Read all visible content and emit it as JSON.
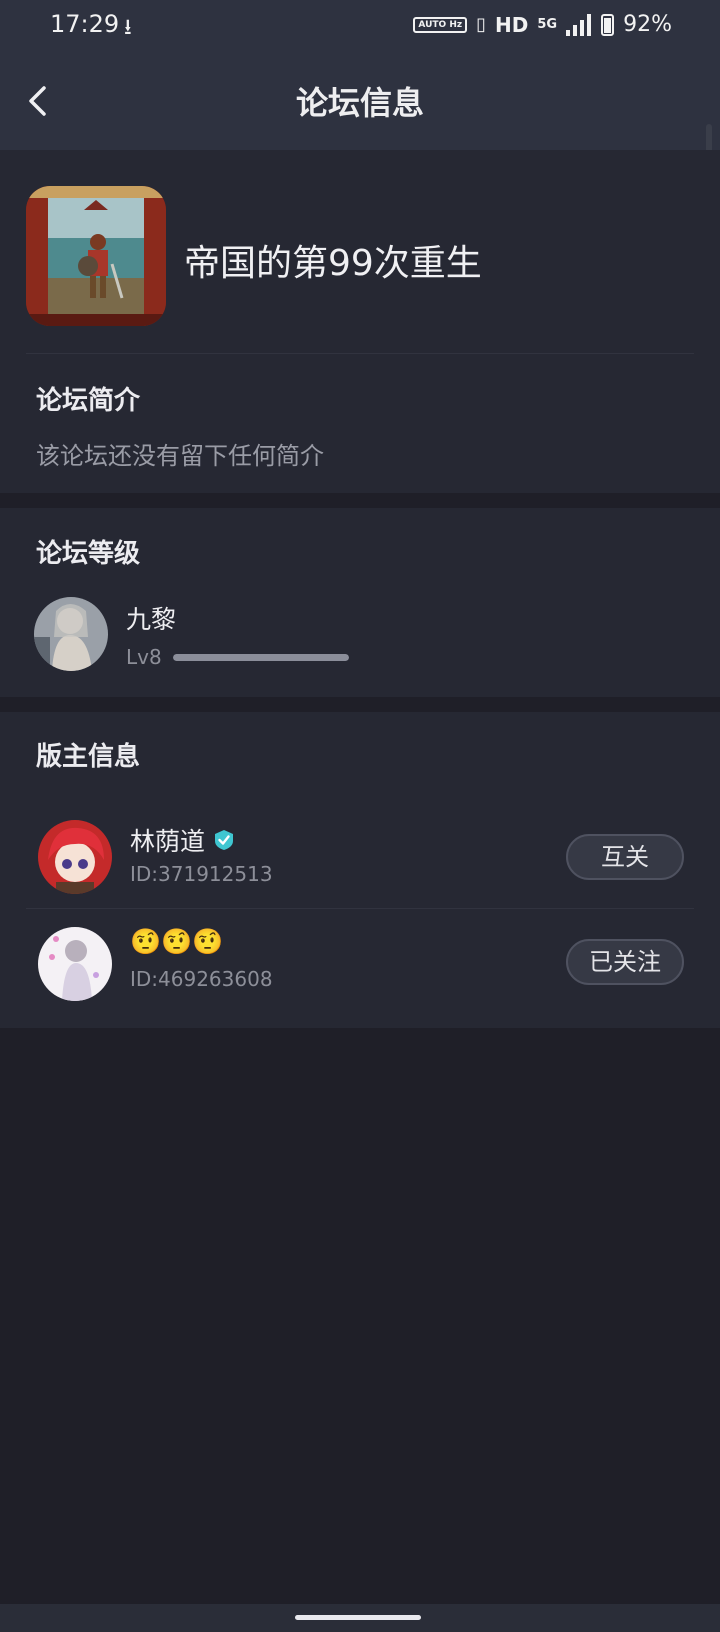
{
  "status_bar": {
    "time": "17:29",
    "download_icon": "download-icon",
    "auto_hz": "AUTO Hz",
    "hd": "HD",
    "network": "5G",
    "battery": "92%"
  },
  "app_bar": {
    "title": "论坛信息",
    "back_icon": "chevron-left-icon"
  },
  "forum": {
    "name": "帝国的第99次重生"
  },
  "intro": {
    "heading": "论坛简介",
    "text": "该论坛还没有留下任何简介"
  },
  "level": {
    "heading": "论坛等级",
    "user_name": "九黎",
    "level_label": "Lv8",
    "progress": 1.0
  },
  "admins": {
    "heading": "版主信息",
    "items": [
      {
        "name": "林荫道",
        "verified": true,
        "id": "ID:371912513",
        "button": "互关"
      },
      {
        "name": "🤨🤨🤨",
        "verified": false,
        "id": "ID:469263608",
        "button": "已关注"
      }
    ]
  },
  "colors": {
    "background": "#1f1f28",
    "card": "#262833",
    "header": "#2e3240",
    "verified": "#3fc6d1"
  }
}
